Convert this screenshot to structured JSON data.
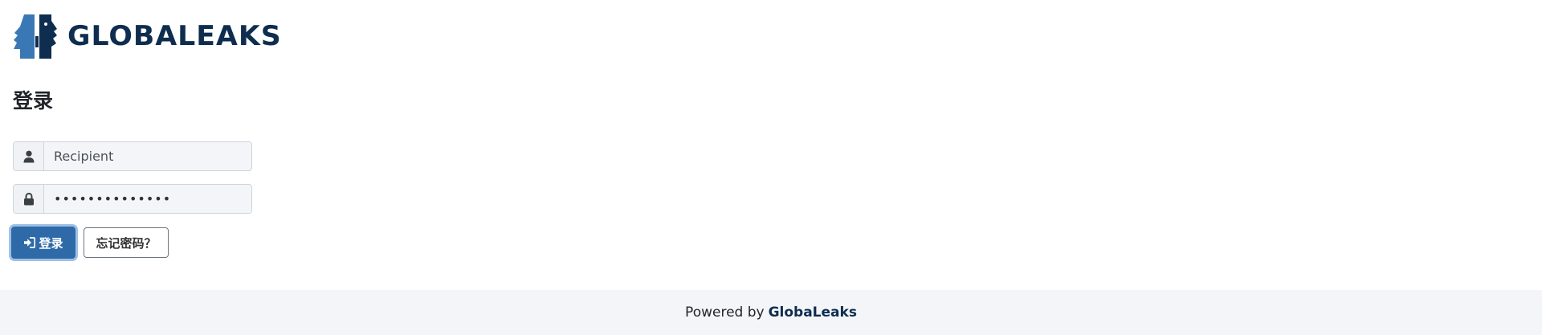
{
  "header": {
    "logo_icon": "globaleaks-faces-logo",
    "brand_text": "GLOBALEAKS"
  },
  "login": {
    "title": "登录",
    "username": {
      "icon": "user-icon",
      "value": "Recipient"
    },
    "password": {
      "icon": "lock-icon",
      "value": "••••••••••••••"
    },
    "submit_icon": "sign-in-icon",
    "submit_label": "登录",
    "forgot_label": "忘记密码？"
  },
  "footer": {
    "powered_by": "Powered by",
    "brand": "GlobaLeaks"
  },
  "colors": {
    "brand_dark": "#0e2d4f",
    "brand_light": "#3a78b5",
    "primary_button": "#2f6aa8",
    "footer_bg": "#f4f5f9"
  }
}
